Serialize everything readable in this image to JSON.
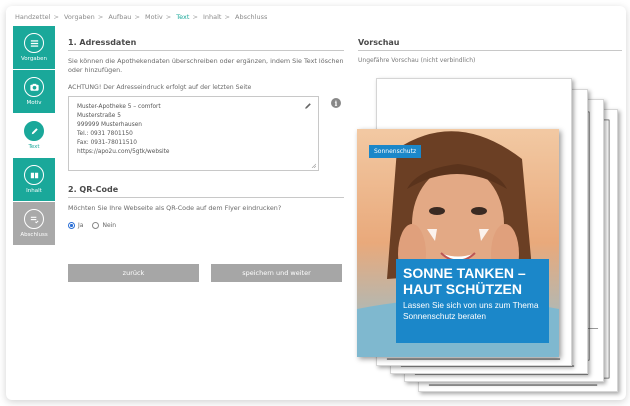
{
  "breadcrumb": [
    {
      "label": "Handzettel",
      "active": false
    },
    {
      "label": "Vorgaben",
      "active": false
    },
    {
      "label": "Aufbau",
      "active": false
    },
    {
      "label": "Motiv",
      "active": false
    },
    {
      "label": "Text",
      "active": true
    },
    {
      "label": "Inhalt",
      "active": false
    },
    {
      "label": "Abschluss",
      "active": false
    }
  ],
  "steps": [
    {
      "label": "Vorgaben",
      "icon": "list-icon",
      "state": "done"
    },
    {
      "label": "Motiv",
      "icon": "camera-icon",
      "state": "done"
    },
    {
      "label": "Text",
      "icon": "pencil-icon",
      "state": "current"
    },
    {
      "label": "Inhalt",
      "icon": "content-icon",
      "state": "done"
    },
    {
      "label": "Abschluss",
      "icon": "checklist-icon",
      "state": "todo"
    }
  ],
  "form": {
    "address_title": "1. Adressdaten",
    "address_desc": "Sie können die Apothekendaten überschreiben oder ergänzen, indem Sie Text löschen oder hinzufügen.",
    "address_note": "ACHTUNG! Der Adresseindruck erfolgt auf der letzten Seite",
    "address_lines": [
      "Muster-Apotheke 5 – comfort",
      "Musterstraße 5",
      "999999 Musterhausen",
      "Tel.: 0931 7801150",
      "Fax: 0931-78011510",
      "https://apo2u.com/5gtk/website"
    ],
    "qr_title": "2. QR-Code",
    "qr_question": "Möchten Sie Ihre Webseite als QR-Code auf dem Flyer eindrucken?",
    "qr_yes": "Ja",
    "qr_no": "Nein",
    "qr_selected": "Ja"
  },
  "buttons": {
    "back": "zurück",
    "next": "speichern und weiter"
  },
  "preview": {
    "title": "Vorschau",
    "subtitle": "Ungefähre Vorschau (nicht verbindlich)",
    "flyer_tag": "Sonnenschutz",
    "flyer_heading_1": "SONNE TANKEN –",
    "flyer_heading_2": "HAUT SCHÜTZEN",
    "flyer_text": "Lassen Sie sich von uns zum Thema Sonnenschutz beraten"
  },
  "colors": {
    "accent": "#1aa89a",
    "inactive": "#a9a9a9",
    "flyer_blue": "#1b87c9"
  }
}
